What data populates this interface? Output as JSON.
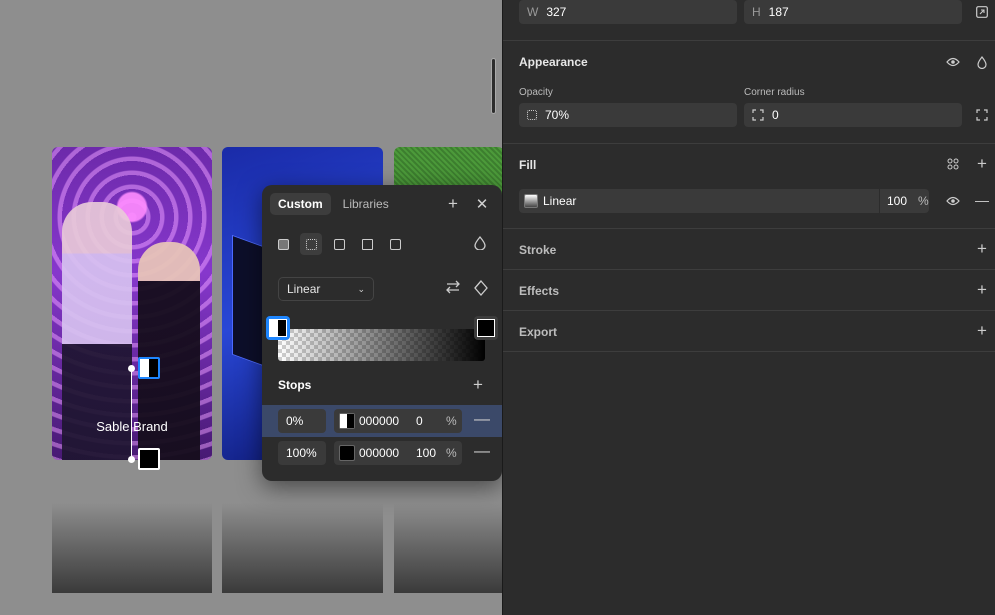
{
  "canvas": {
    "brand_text": "Sable Brand"
  },
  "popup": {
    "tabs": [
      {
        "label": "Custom",
        "active": true
      },
      {
        "label": "Libraries",
        "active": false
      }
    ],
    "type_select": "Linear",
    "stops_label": "Stops",
    "stops": [
      {
        "position": "0%",
        "hex": "000000",
        "alpha": "0",
        "unit": "%",
        "selected": true
      },
      {
        "position": "100%",
        "hex": "000000",
        "alpha": "100",
        "unit": "%",
        "selected": false
      }
    ]
  },
  "panel": {
    "w_label": "W",
    "w_value": "327",
    "h_label": "H",
    "h_value": "187",
    "appearance": {
      "title": "Appearance",
      "opacity_label": "Opacity",
      "opacity_value": "70%",
      "radius_label": "Corner radius",
      "radius_value": "0"
    },
    "fill": {
      "title": "Fill",
      "type": "Linear",
      "opacity": "100",
      "unit": "%"
    },
    "stroke_title": "Stroke",
    "effects_title": "Effects",
    "export_title": "Export"
  },
  "colors": {
    "panel_bg": "#2c2c2c",
    "accent_blue": "#1e86ff",
    "selected_row": "#3b4969"
  }
}
